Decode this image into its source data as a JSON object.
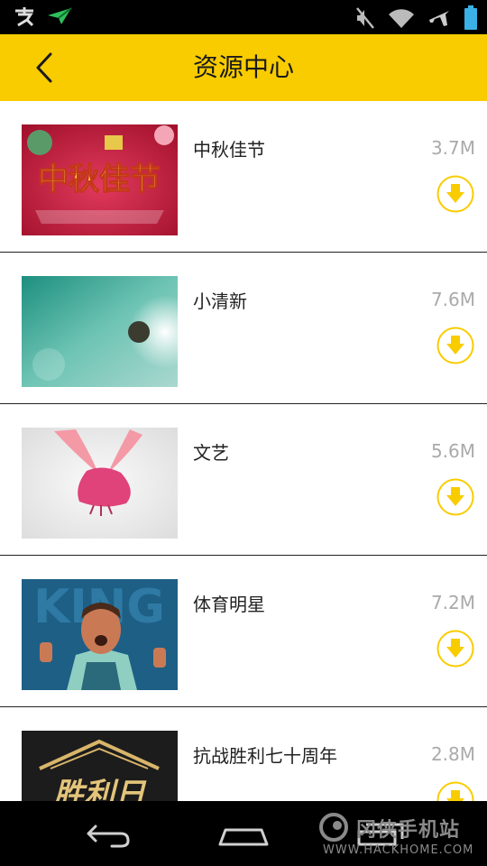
{
  "header": {
    "title": "资源中心",
    "back_icon": "chevron-left-icon"
  },
  "status_bar": {
    "left_icons": [
      "chat-app-icon",
      "paper-plane-icon"
    ],
    "right_icons": [
      "mute-icon",
      "wifi-icon",
      "airplane-icon",
      "battery-icon"
    ]
  },
  "resources": [
    {
      "name": "中秋佳节",
      "size": "3.7M",
      "thumb_text": "中秋佳节"
    },
    {
      "name": "小清新",
      "size": "7.6M"
    },
    {
      "name": "文艺",
      "size": "5.6M"
    },
    {
      "name": "体育明星",
      "size": "7.2M",
      "thumb_text": "KING"
    },
    {
      "name": "抗战胜利七十周年",
      "size": "2.8M",
      "thumb_text": "胜利日"
    }
  ],
  "colors": {
    "accent": "#F9CC00",
    "size_text": "#aaaaaa"
  },
  "watermark": {
    "brand": "冈侠手机站",
    "url": "WWW.HACKHOME.COM"
  }
}
